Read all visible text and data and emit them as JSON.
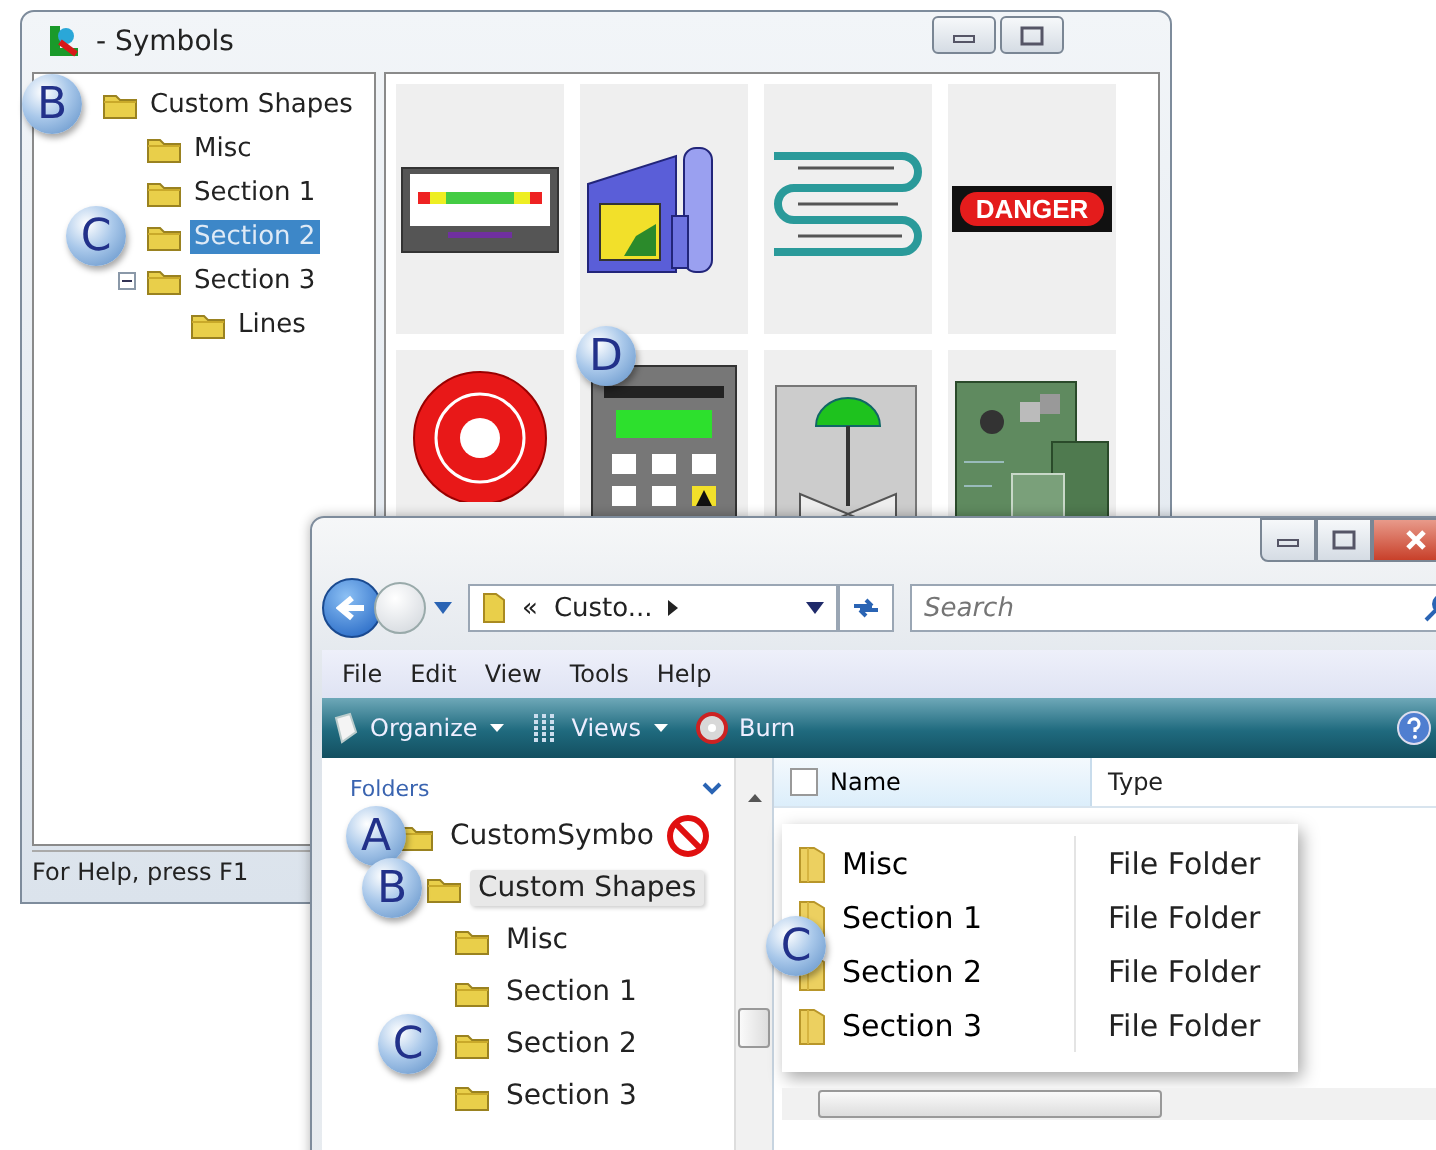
{
  "symbols_window": {
    "title": "- Symbols",
    "tree": {
      "label": "Custom Shapes",
      "selected": false,
      "callout": "B",
      "children": [
        {
          "label": "Misc",
          "selected": false
        },
        {
          "label": "Section 1",
          "selected": false
        },
        {
          "label": "Section 2",
          "selected": true,
          "callout": "C"
        },
        {
          "label": "Section 3",
          "selected": false,
          "expanded": true,
          "children": [
            {
              "label": "Lines",
              "selected": false
            }
          ]
        }
      ]
    },
    "symbols": [
      {
        "kind": "meter"
      },
      {
        "kind": "machine"
      },
      {
        "kind": "coil"
      },
      {
        "kind": "sign",
        "text": "DANGER"
      },
      {
        "kind": "stop"
      },
      {
        "kind": "keypad",
        "callout": "D"
      },
      {
        "kind": "valve"
      },
      {
        "kind": "board"
      }
    ],
    "status": "For Help, press F1"
  },
  "explorer": {
    "address_prefix": "«",
    "address": "Custo...",
    "search_placeholder": "Search",
    "menu": [
      "File",
      "Edit",
      "View",
      "Tools",
      "Help"
    ],
    "toolbar": [
      {
        "kind": "organize",
        "label": "Organize"
      },
      {
        "kind": "views",
        "label": "Views"
      },
      {
        "kind": "burn",
        "label": "Burn"
      }
    ],
    "folders_header": "Folders",
    "tree": {
      "label": "CustomSymbo",
      "highlighted": false,
      "blocked": true,
      "callout": "A",
      "children": [
        {
          "label": "Custom Shapes",
          "highlighted": true,
          "callout": "B",
          "children": [
            {
              "label": "Misc",
              "highlighted": false
            },
            {
              "label": "Section 1",
              "highlighted": false
            },
            {
              "label": "Section 2",
              "highlighted": false,
              "callout": "C"
            },
            {
              "label": "Section 3",
              "highlighted": false
            }
          ]
        }
      ]
    },
    "columns": [
      "Name",
      "Type"
    ],
    "select_all_checked": false,
    "files": [
      {
        "name": "Misc",
        "type": "File Folder"
      },
      {
        "name": "Section 1",
        "type": "File Folder",
        "callout": "C"
      },
      {
        "name": "Section 2",
        "type": "File Folder"
      },
      {
        "name": "Section 3",
        "type": "File Folder"
      }
    ]
  }
}
